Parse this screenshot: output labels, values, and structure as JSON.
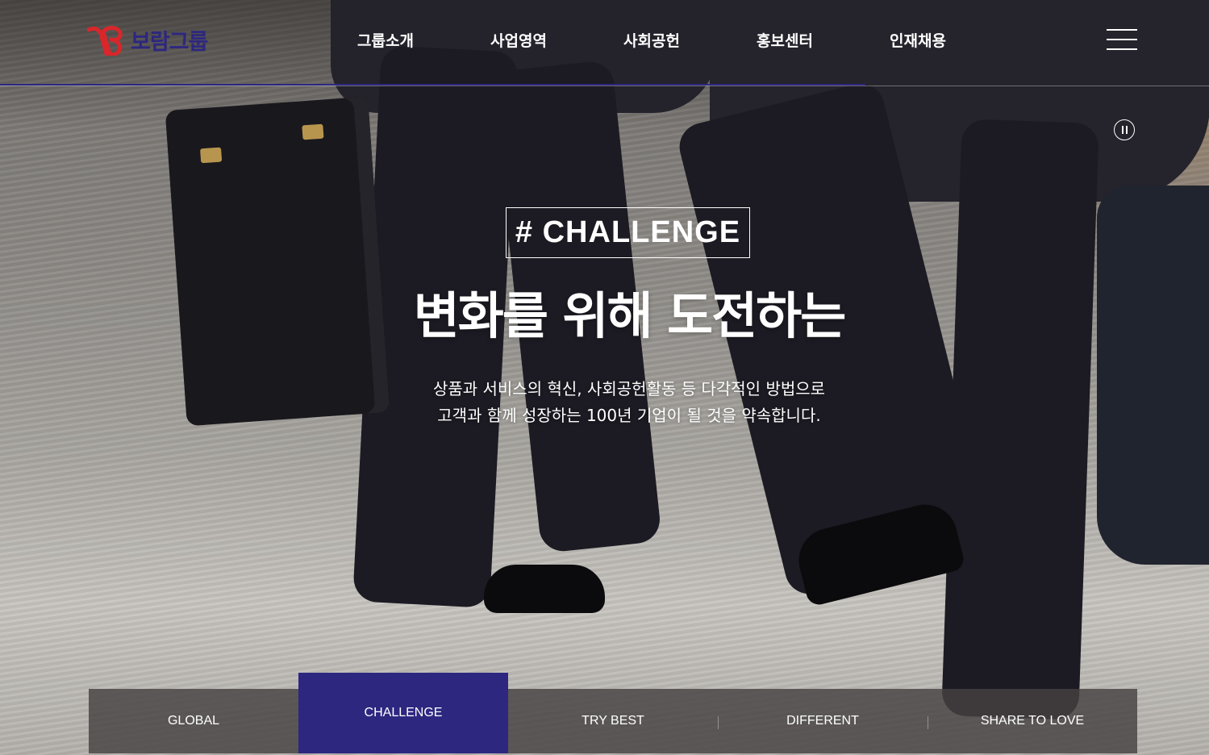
{
  "brand": {
    "name": "보람그룹",
    "primary_color": "#2d2780",
    "accent_color": "#d8262b"
  },
  "nav": {
    "items": [
      {
        "label": "그룹소개"
      },
      {
        "label": "사업영역"
      },
      {
        "label": "사회공헌"
      },
      {
        "label": "홍보센터"
      },
      {
        "label": "인재채용"
      }
    ],
    "menu_icon": "hamburger-menu-icon"
  },
  "slider": {
    "pause_icon": "pause-icon",
    "tag": "# CHALLENGE",
    "headline": "변화를 위해 도전하는",
    "description_line1": "상품과 서비스의 혁신, 사회공헌활동 등 다각적인 방법으로",
    "description_line2": "고객과 함께 성장하는 100년 기업이 될 것을 약속합니다.",
    "tabs": [
      {
        "label": "GLOBAL"
      },
      {
        "label": "CHALLENGE"
      },
      {
        "label": "TRY BEST"
      },
      {
        "label": "DIFFERENT"
      },
      {
        "label": "SHARE TO LOVE"
      }
    ],
    "active_tab": "CHALLENGE"
  }
}
